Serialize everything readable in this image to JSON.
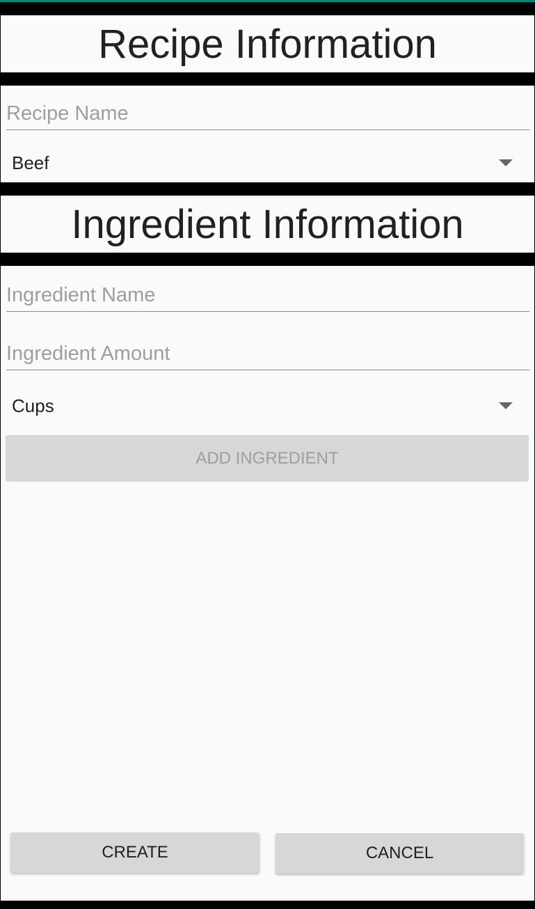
{
  "recipe_section": {
    "title": "Recipe Information",
    "name_placeholder": "Recipe Name",
    "category_selected": "Beef"
  },
  "ingredient_section": {
    "title": "Ingredient Information",
    "name_placeholder": "Ingredient Name",
    "amount_placeholder": "Ingredient Amount",
    "unit_selected": "Cups",
    "add_label": "ADD INGREDIENT"
  },
  "actions": {
    "create_label": "CREATE",
    "cancel_label": "CANCEL"
  },
  "colors": {
    "accent": "#00897b",
    "button": "#d6d7d7",
    "background": "#fafafa"
  }
}
